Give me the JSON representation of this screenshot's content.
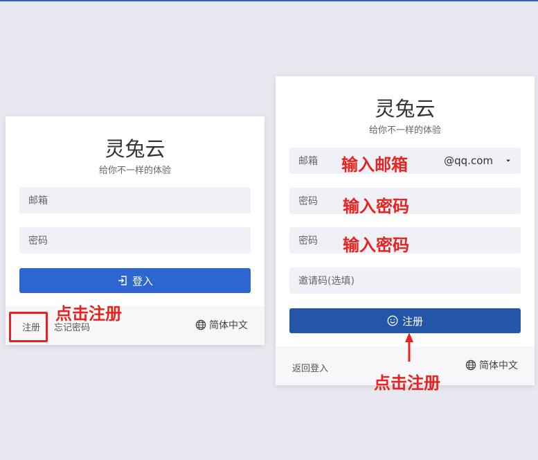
{
  "left_card": {
    "title": "灵兔云",
    "subtitle": "给你不一样的体验",
    "email_placeholder": "邮箱",
    "password_placeholder": "密码",
    "login_label": "登入",
    "register_link": "注册",
    "forgot_link": "忘记密码",
    "language": "简体中文"
  },
  "right_card": {
    "title": "灵兔云",
    "subtitle": "给你不一样的体验",
    "email_label": "邮箱",
    "email_domain": "@qq.com",
    "password_label": "密码",
    "confirm_password_label": "密码",
    "invite_placeholder": "邀请码(选填)",
    "register_label": "注册",
    "back_link": "返回登入",
    "language": "简体中文"
  },
  "annotations": {
    "click_register_left": "点击注册",
    "enter_email": "输入邮箱",
    "enter_password": "输入密码",
    "enter_password_again": "输入密码",
    "click_register_right": "点击注册"
  },
  "colors": {
    "background": "#e7e8f0",
    "login_button": "#2d66d0",
    "register_button": "#2355a8",
    "annotation": "#e8231f"
  },
  "icons": {
    "login": "login-icon",
    "register": "smile-icon",
    "language": "globe-icon",
    "dropdown": "caret-down-icon"
  }
}
